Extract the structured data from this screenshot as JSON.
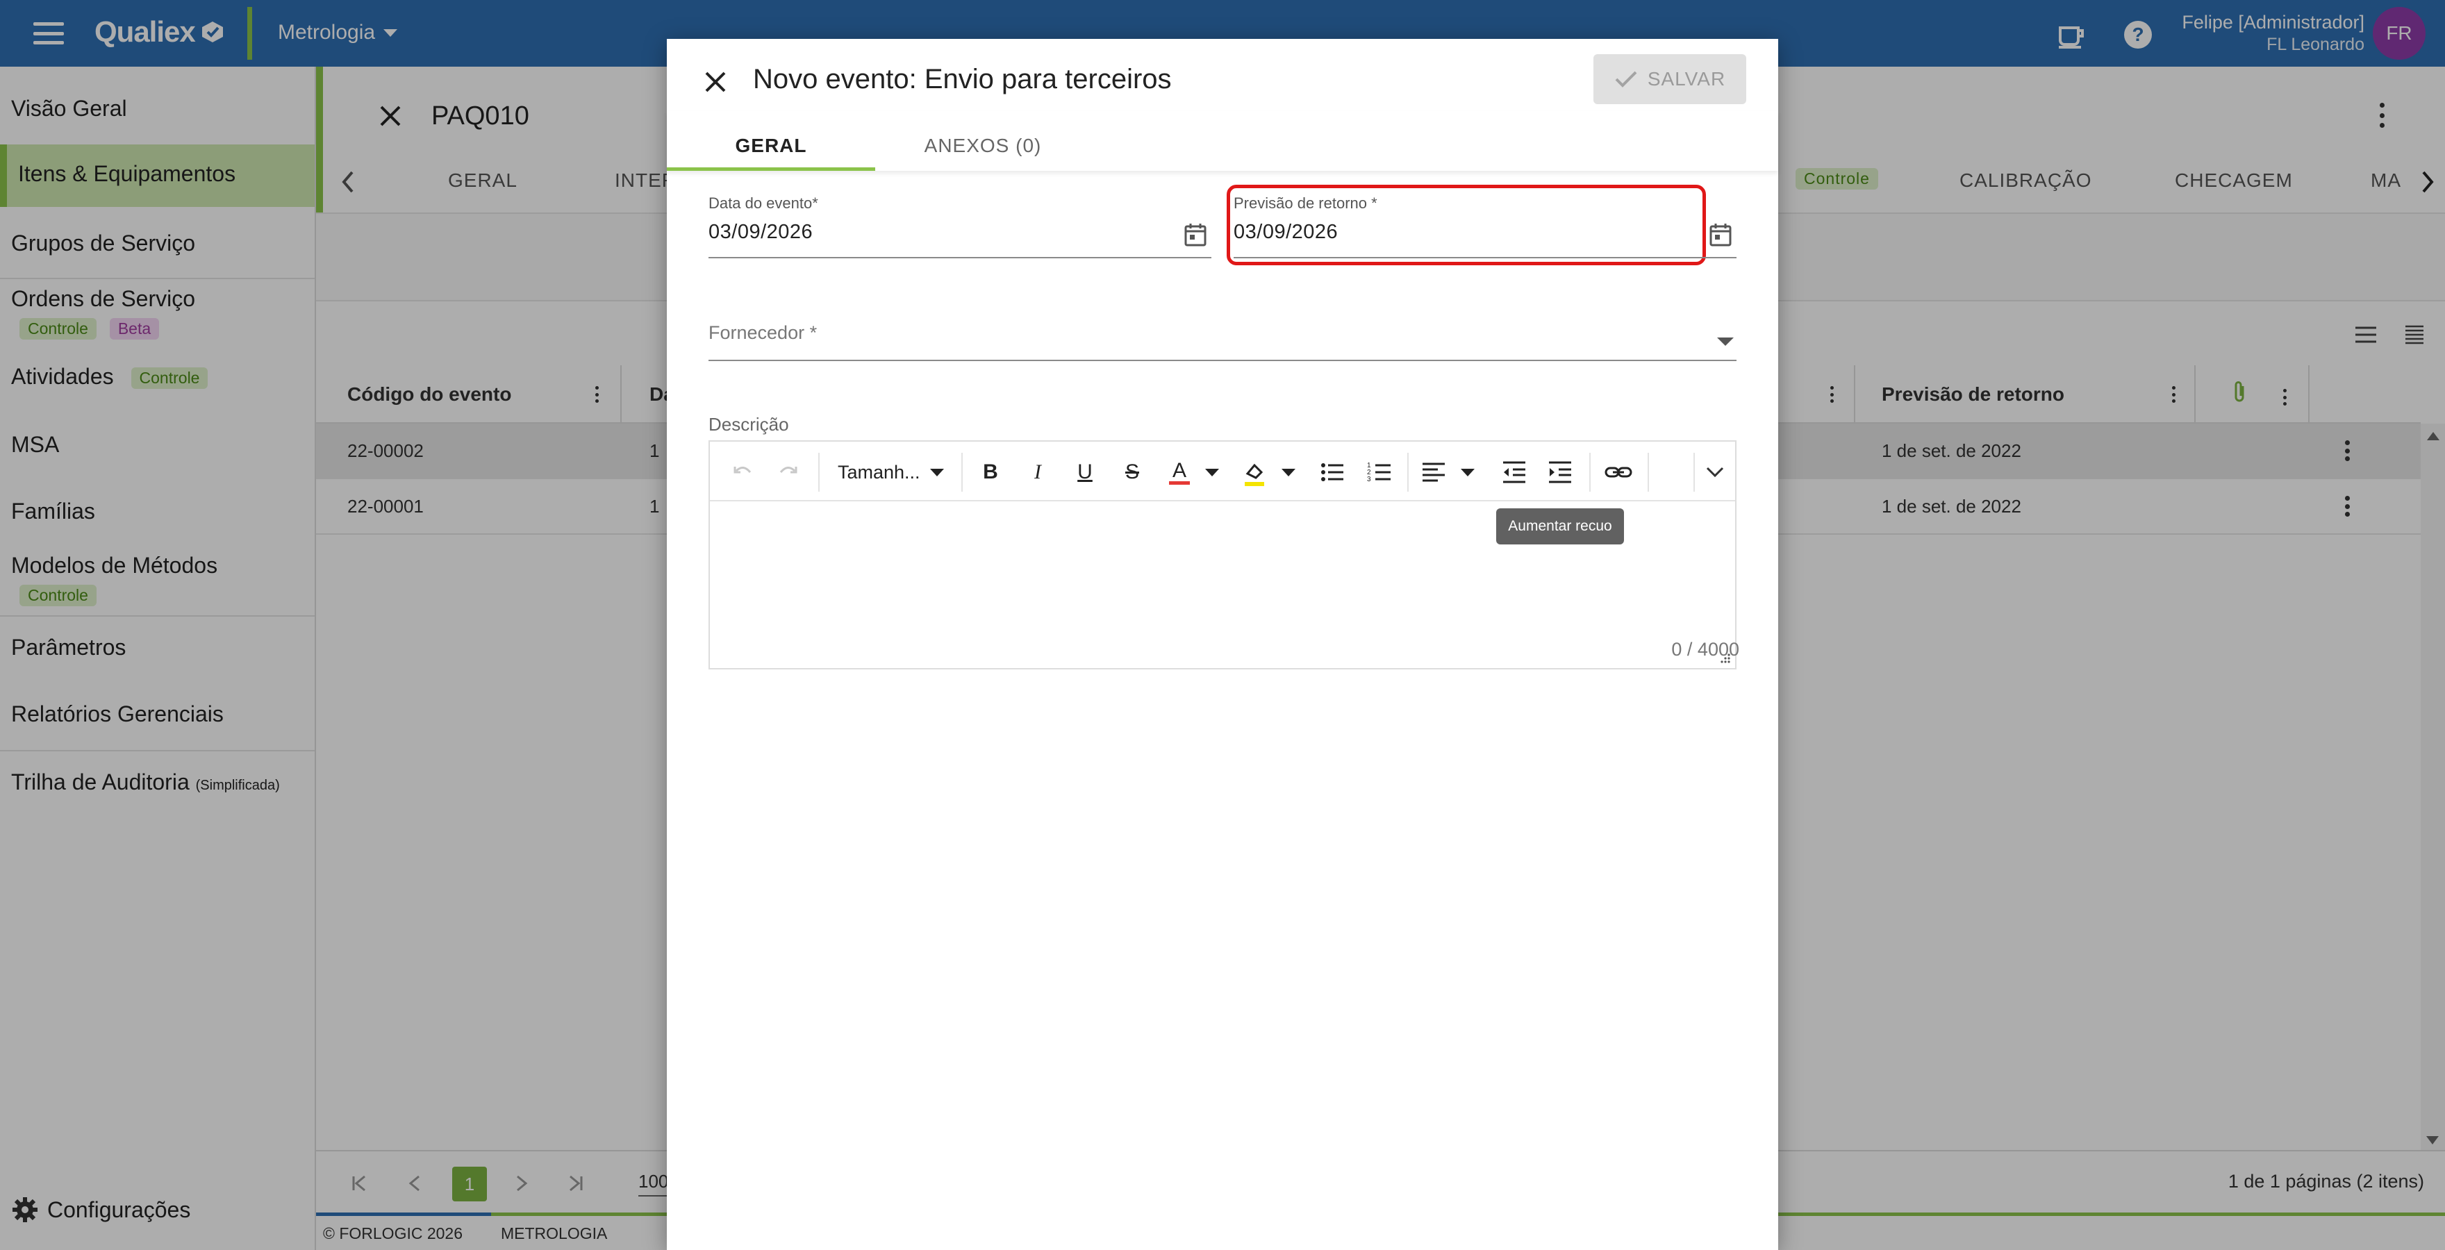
{
  "topbar": {
    "brand": "Qualiex",
    "module": "Metrologia",
    "user_name": "Felipe [Administrador]",
    "user_org": "FL Leonardo",
    "avatar_initials": "FR"
  },
  "sidebar": {
    "items": [
      {
        "label": "Visão Geral"
      },
      {
        "label": "Itens & Equipamentos"
      },
      {
        "label": "Grupos de Serviço"
      },
      {
        "label": "Ordens de Serviço",
        "tags": [
          "Controle",
          "Beta"
        ]
      },
      {
        "label": "Atividades",
        "tags": [
          "Controle"
        ]
      },
      {
        "label": "MSA"
      },
      {
        "label": "Famílias"
      },
      {
        "label": "Modelos de Métodos",
        "tags": [
          "Controle"
        ]
      },
      {
        "label": "Parâmetros"
      },
      {
        "label": "Relatórios Gerenciais"
      },
      {
        "label": "Trilha de Auditoria",
        "suffix": "(Simplificada)"
      }
    ],
    "settings_label": "Configurações"
  },
  "record": {
    "title": "PAQ010",
    "tabs": [
      "GERAL",
      "INTER",
      "Controle",
      "CALIBRAÇÃO",
      "CHECAGEM",
      "MA"
    ]
  },
  "grid": {
    "headers": [
      "Código do evento",
      "Da",
      "Previsão de retorno"
    ],
    "rows": [
      {
        "code": "22-00002",
        "date_partial": "1",
        "return": "1 de set. de 2022"
      },
      {
        "code": "22-00001",
        "date_partial": "1",
        "return": "1 de set. de 2022"
      }
    ],
    "pager": {
      "current_page": "1",
      "page_size_partial": "100",
      "summary": "1 de 1 páginas (2 itens)"
    }
  },
  "footer": {
    "copyright": "© FORLOGIC 2026",
    "module": "METROLOGIA"
  },
  "modal": {
    "title": "Novo evento: Envio para terceiros",
    "save_label": "SALVAR",
    "tabs": [
      "GERAL",
      "ANEXOS (0)"
    ],
    "fields": {
      "event_date_label": "Data do evento*",
      "event_date_value": "03/09/2026",
      "return_date_label": "Previsão de retorno *",
      "return_date_value": "03/09/2026",
      "supplier_label": "Fornecedor *",
      "description_label": "Descrição"
    },
    "editor": {
      "font_size_label": "Tamanh...",
      "tooltip": "Aumentar recuo",
      "counter": "0 / 4000"
    }
  }
}
